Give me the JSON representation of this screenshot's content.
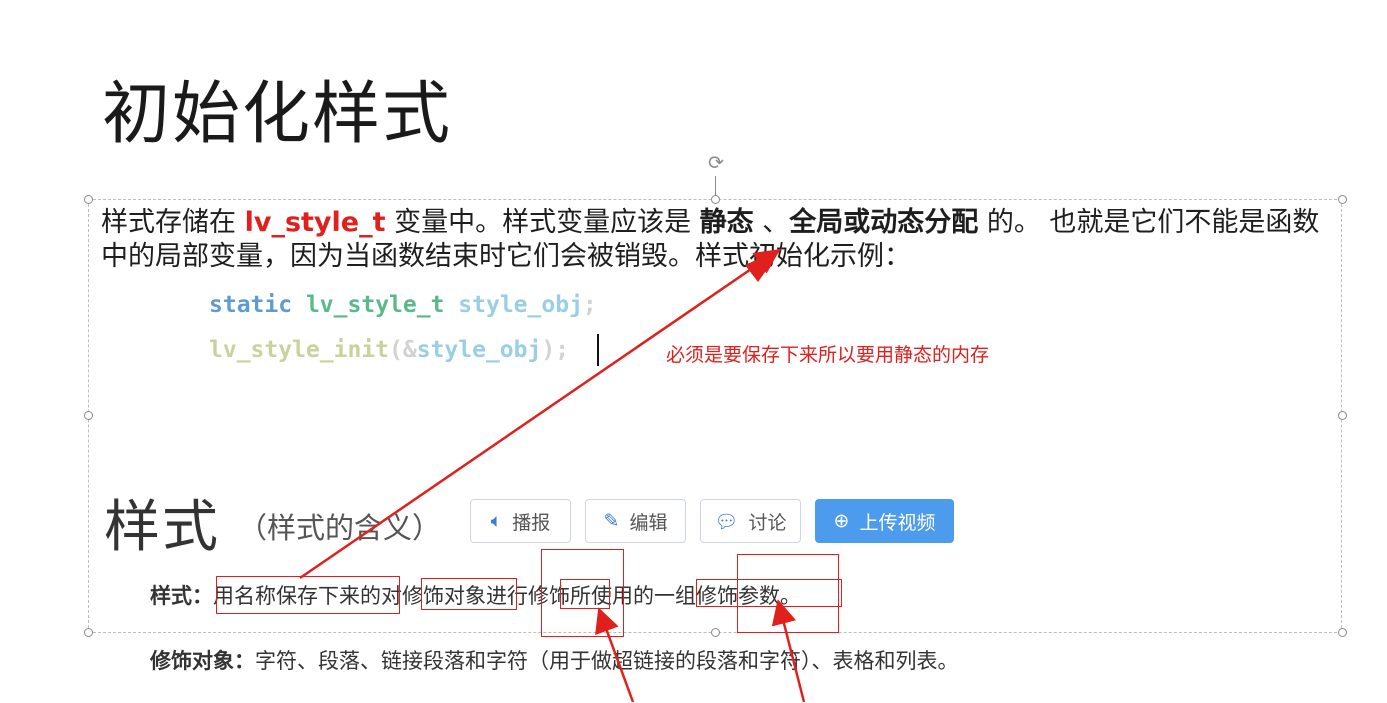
{
  "slide": {
    "title": "初始化样式",
    "paragraph": {
      "p1": "样式存储在 ",
      "kw": "lv_style_t",
      "p2": " 变量中。样式变量应该是 ",
      "b1": "静态",
      "p3": " 、",
      "b2": "全局或动态分配",
      "p4": " 的。 也就是它们不能是函数中的局部变量，因为当函数结束时它们会被销毁。样式初始化示例："
    },
    "code": {
      "line1": {
        "kw": "static",
        "type": "lv_style_t",
        "var": "style_obj",
        "punc": ";"
      },
      "line2": {
        "fn": "lv_style_init",
        "open": "(&",
        "var": "style_obj",
        "close": ");"
      }
    },
    "annotation": "必须是要保存下来所以要用静态的内存"
  },
  "baike": {
    "heading": "样式",
    "heading_sub": "（样式的含义）",
    "buttons": [
      {
        "icon": "speaker-icon",
        "label": "播报"
      },
      {
        "icon": "pencil-icon",
        "label": "编辑"
      },
      {
        "icon": "comment-icon",
        "label": "讨论"
      },
      {
        "icon": "plus-circle-icon",
        "label": "上传视频"
      }
    ],
    "def1": {
      "label": "样式：",
      "text": "用名称保存下来的对修饰对象进行修饰所使用的一组修饰参数。"
    },
    "def2": {
      "label": "修饰对象：",
      "text": "字符、段落、链接段落和字符（用于做超链接的段落和字符）、表格和列表。"
    }
  },
  "colors": {
    "accent_red": "#e0201c",
    "button_primary": "#4c9bed"
  }
}
